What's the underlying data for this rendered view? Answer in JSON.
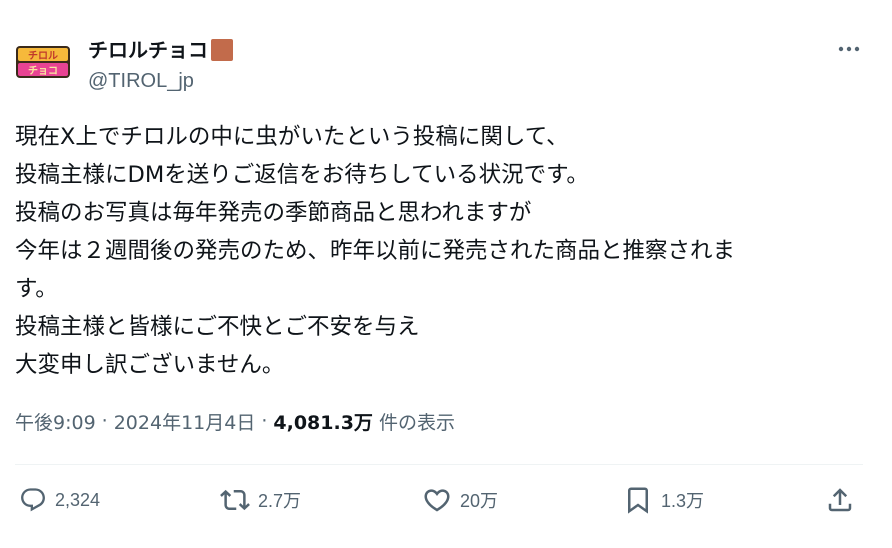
{
  "author": {
    "display_name": "チロルチョコ",
    "handle": "@TIROL_jp",
    "avatar_text_top": "チロル",
    "avatar_text_bottom": "チョコ",
    "badge_color": "#c26b4b"
  },
  "tweet": {
    "lines": [
      "現在X上でチロルの中に虫がいたという投稿に関して、",
      "投稿主様にDMを送りご返信をお待ちしている状況です。",
      "投稿のお写真は毎年発売の季節商品と思われますが",
      "今年は２週間後の発売のため、昨年以前に発売された商品と推察されま",
      "す。",
      "投稿主様と皆様にご不快とご不安を与え",
      "大変申し訳ございません。"
    ]
  },
  "meta": {
    "time": "午後9:09",
    "separator": "·",
    "date": "2024年11月4日",
    "views_count": "4,081.3万",
    "views_label": "件の表示"
  },
  "actions": {
    "reply_count": "2,324",
    "repost_count": "2.7万",
    "like_count": "20万",
    "bookmark_count": "1.3万"
  },
  "icons": {
    "more": "more-icon",
    "reply": "reply-icon",
    "repost": "repost-icon",
    "like": "heart-icon",
    "bookmark": "bookmark-icon",
    "share": "share-icon"
  },
  "colors": {
    "text": "#0f1419",
    "secondary": "#536471",
    "divider": "#eff3f4"
  }
}
